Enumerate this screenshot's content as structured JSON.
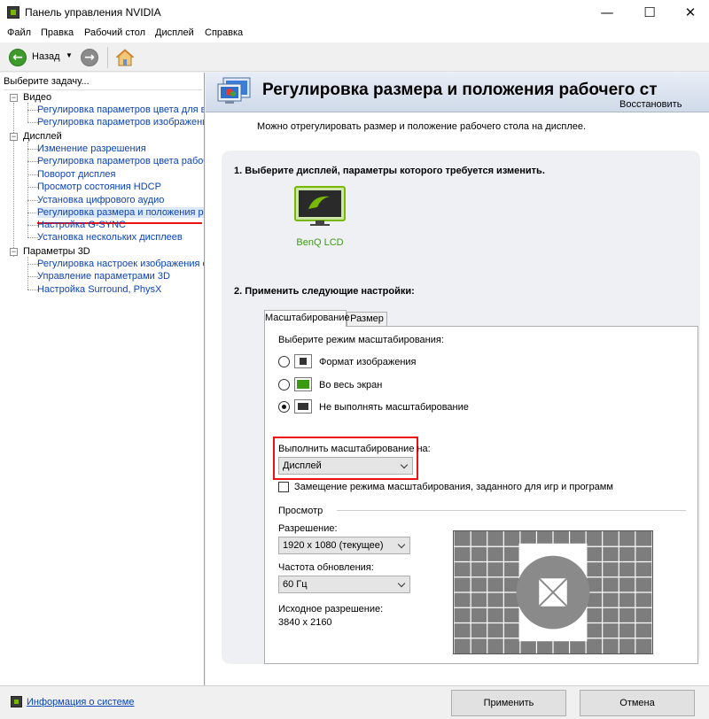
{
  "window": {
    "title": "Панель управления NVIDIA",
    "controls": {
      "minimize": "—",
      "maximize": "☐",
      "close": "✕"
    }
  },
  "menu": [
    "Файл",
    "Правка",
    "Рабочий стол",
    "Дисплей",
    "Справка"
  ],
  "toolbar": {
    "back_label": "Назад"
  },
  "sidebar": {
    "prompt": "Выберите задачу...",
    "groups": [
      {
        "label": "Видео",
        "items": [
          "Регулировка параметров цвета для вид",
          "Регулировка параметров изображения д"
        ]
      },
      {
        "label": "Дисплей",
        "items": [
          "Изменение разрешения",
          "Регулировка параметров цвета рабочег",
          "Поворот дисплея",
          "Просмотр состояния HDCP",
          "Установка цифрового аудио",
          "Регулировка размера и положения рабо",
          "Настройка G-SYNC",
          "Установка нескольких дисплеев"
        ]
      },
      {
        "label": "Параметры 3D",
        "items": [
          "Регулировка настроек изображения с пр",
          "Управление параметрами 3D",
          "Настройка Surround, PhysX"
        ]
      }
    ],
    "selected_item": "Регулировка размера и положения рабо"
  },
  "header": {
    "title": "Регулировка размера и положения рабочего ст",
    "restore": "Восстановить"
  },
  "description": "Можно отрегулировать размер и положение рабочего стола на дисплее.",
  "section1": {
    "title": "1. Выберите дисплей, параметры которого требуется изменить.",
    "display_name": "BenQ LCD"
  },
  "section2": {
    "title": "2. Применить следующие настройки:",
    "tabs": [
      "Масштабирование",
      "Размер"
    ],
    "active_tab": "Масштабирование",
    "mode_label": "Выберите режим масштабирования:",
    "options": [
      "Формат изображения",
      "Во весь экран",
      "Не выполнять масштабирование"
    ],
    "selected_option": "Не выполнять масштабирование",
    "perform_on_label": "Выполнить масштабирование на:",
    "perform_on_value": "Дисплей",
    "override_label": "Замещение режима масштабирования, заданного для игр и программ",
    "override_checked": false,
    "preview_label": "Просмотр",
    "resolution_label": "Разрешение:",
    "resolution_value": "1920 x 1080 (текущее)",
    "refresh_label": "Частота обновления:",
    "refresh_value": "60 Гц",
    "native_label": "Исходное разрешение:",
    "native_value": "3840 x 2160"
  },
  "footer": {
    "system_info": "Информация о системе",
    "apply": "Применить",
    "cancel": "Отмена"
  },
  "colors": {
    "nvidia_green": "#76b900",
    "link_blue": "#0b43b8",
    "highlight_red": "#e11111"
  }
}
